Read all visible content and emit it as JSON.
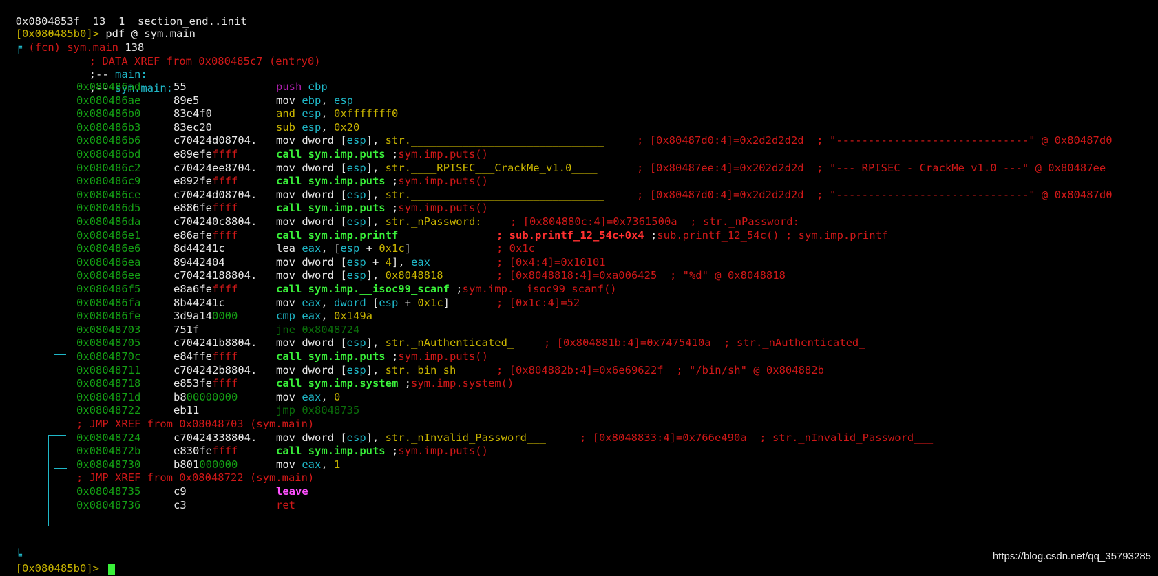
{
  "header": {
    "line1": "0x0804853f  13  1  section_end..init",
    "prompt_addr": "[0x080485b0]>",
    "command": " pdf @ sym.main"
  },
  "func": {
    "marker": "╒",
    "label": " (fcn) sym.main",
    "size": " 138"
  },
  "xref1": "; DATA XREF from 0x080485c7 (entry0)",
  "labels": [
    {
      "prefix": ";-- ",
      "name": "main:"
    },
    {
      "prefix": ";-- ",
      "name": "sym.main:"
    }
  ],
  "rows": [
    {
      "addr": "0x080486ad",
      "bytes": "55",
      "bytes_tail": "",
      "ins": [
        {
          "t": "push",
          "c": "m"
        },
        {
          "t": " ebp",
          "c": "cy"
        }
      ],
      "comment": []
    },
    {
      "addr": "0x080486ae",
      "bytes": "89e5",
      "bytes_tail": "",
      "ins": [
        {
          "t": "mov ",
          "c": "w"
        },
        {
          "t": "ebp",
          "c": "cy"
        },
        {
          "t": ", ",
          "c": "w"
        },
        {
          "t": "esp",
          "c": "cy"
        }
      ],
      "comment": []
    },
    {
      "addr": "0x080486b0",
      "bytes": "83e4f0",
      "bytes_tail": "",
      "ins": [
        {
          "t": "and ",
          "c": "y"
        },
        {
          "t": "esp",
          "c": "cy"
        },
        {
          "t": ", ",
          "c": "w"
        },
        {
          "t": "0xfffffff0",
          "c": "y"
        }
      ],
      "comment": []
    },
    {
      "addr": "0x080486b3",
      "bytes": "83ec20",
      "bytes_tail": "",
      "ins": [
        {
          "t": "sub ",
          "c": "y"
        },
        {
          "t": "esp",
          "c": "cy"
        },
        {
          "t": ", ",
          "c": "w"
        },
        {
          "t": "0x20",
          "c": "y"
        }
      ],
      "comment": []
    },
    {
      "addr": "0x080486b6",
      "bytes": "c70424d08704.",
      "bytes_tail": "",
      "ins": [
        {
          "t": "mov dword [",
          "c": "w"
        },
        {
          "t": "esp",
          "c": "cy"
        },
        {
          "t": "], ",
          "c": "w"
        },
        {
          "t": "str.",
          "c": "y"
        },
        {
          "t": "______________________________",
          "c": "y"
        }
      ],
      "comment": [
        {
          "t": "; [0x80487d0:4]=0x2d2d2d2d  ; \"------------------------------\" @ 0x80487d0",
          "c": "r"
        }
      ]
    },
    {
      "addr": "0x080486bd",
      "bytes": "e89efe",
      "bytes_tail": "ffff",
      "ins": [
        {
          "t": "call sym.imp.puts",
          "c": "gb"
        },
        {
          "t": " ;",
          "c": "w"
        },
        {
          "t": "sym.imp.puts()",
          "c": "r"
        }
      ],
      "comment": []
    },
    {
      "addr": "0x080486c2",
      "bytes": "c70424ee8704.",
      "bytes_tail": "",
      "ins": [
        {
          "t": "mov dword [",
          "c": "w"
        },
        {
          "t": "esp",
          "c": "cy"
        },
        {
          "t": "], ",
          "c": "w"
        },
        {
          "t": "str.____RPISEC___CrackMe_v1.0____",
          "c": "y"
        }
      ],
      "comment": [
        {
          "t": "; [0x80487ee:4]=0x202d2d2d  ; \"--- RPISEC - CrackMe v1.0 ---\" @ 0x80487ee",
          "c": "r"
        }
      ]
    },
    {
      "addr": "0x080486c9",
      "bytes": "e892fe",
      "bytes_tail": "ffff",
      "ins": [
        {
          "t": "call sym.imp.puts",
          "c": "gb"
        },
        {
          "t": " ;",
          "c": "w"
        },
        {
          "t": "sym.imp.puts()",
          "c": "r"
        }
      ],
      "comment": []
    },
    {
      "addr": "0x080486ce",
      "bytes": "c70424d08704.",
      "bytes_tail": "",
      "ins": [
        {
          "t": "mov dword [",
          "c": "w"
        },
        {
          "t": "esp",
          "c": "cy"
        },
        {
          "t": "], ",
          "c": "w"
        },
        {
          "t": "str.",
          "c": "y"
        },
        {
          "t": "______________________________",
          "c": "y"
        }
      ],
      "comment": [
        {
          "t": "; [0x80487d0:4]=0x2d2d2d2d  ; \"------------------------------\" @ 0x80487d0",
          "c": "r"
        }
      ]
    },
    {
      "addr": "0x080486d5",
      "bytes": "e886fe",
      "bytes_tail": "ffff",
      "ins": [
        {
          "t": "call sym.imp.puts",
          "c": "gb"
        },
        {
          "t": " ;",
          "c": "w"
        },
        {
          "t": "sym.imp.puts()",
          "c": "r"
        }
      ],
      "comment": []
    },
    {
      "addr": "0x080486da",
      "bytes": "c704240c8804.",
      "bytes_tail": "",
      "ins": [
        {
          "t": "mov dword [",
          "c": "w"
        },
        {
          "t": "esp",
          "c": "cy"
        },
        {
          "t": "], ",
          "c": "w"
        },
        {
          "t": "str._nPassword:",
          "c": "y"
        }
      ],
      "comment": [
        {
          "t": "; [0x804880c:4]=0x7361500a  ; str._nPassword:",
          "c": "r"
        }
      ]
    },
    {
      "addr": "0x080486e1",
      "bytes": "e86afe",
      "bytes_tail": "ffff",
      "ins": [
        {
          "t": "call sym.imp.printf",
          "c": "gb"
        }
      ],
      "comment": [
        {
          "t": "; sub.printf_12_54c+0x4",
          "c": "rb"
        },
        {
          "t": " ;",
          "c": "w"
        },
        {
          "t": "sub.printf_12_54c() ; sym.imp.printf",
          "c": "r"
        }
      ]
    },
    {
      "addr": "0x080486e6",
      "bytes": "8d44241c",
      "bytes_tail": "",
      "ins": [
        {
          "t": "lea ",
          "c": "w"
        },
        {
          "t": "eax",
          "c": "cy"
        },
        {
          "t": ", [",
          "c": "w"
        },
        {
          "t": "esp",
          "c": "cy"
        },
        {
          "t": " + ",
          "c": "w"
        },
        {
          "t": "0x1c",
          "c": "y"
        },
        {
          "t": "]",
          "c": "w"
        }
      ],
      "comment": [
        {
          "t": "; 0x1c",
          "c": "r"
        }
      ]
    },
    {
      "addr": "0x080486ea",
      "bytes": "89442404",
      "bytes_tail": "",
      "ins": [
        {
          "t": "mov dword [",
          "c": "w"
        },
        {
          "t": "esp",
          "c": "cy"
        },
        {
          "t": " + ",
          "c": "w"
        },
        {
          "t": "4",
          "c": "y"
        },
        {
          "t": "], ",
          "c": "w"
        },
        {
          "t": "eax",
          "c": "cy"
        }
      ],
      "comment": [
        {
          "t": "; [0x4:4]=0x10101",
          "c": "r"
        }
      ]
    },
    {
      "addr": "0x080486ee",
      "bytes": "c70424188804.",
      "bytes_tail": "",
      "ins": [
        {
          "t": "mov dword [",
          "c": "w"
        },
        {
          "t": "esp",
          "c": "cy"
        },
        {
          "t": "], ",
          "c": "w"
        },
        {
          "t": "0x8048818",
          "c": "y"
        }
      ],
      "comment": [
        {
          "t": "; [0x8048818:4]=0xa006425  ; \"%d\" @ 0x8048818",
          "c": "r"
        }
      ]
    },
    {
      "addr": "0x080486f5",
      "bytes": "e8a6fe",
      "bytes_tail": "ffff",
      "ins": [
        {
          "t": "call sym.imp.__isoc99_scanf",
          "c": "gb"
        },
        {
          "t": " ;",
          "c": "w"
        },
        {
          "t": "sym.imp.__isoc99_scanf()",
          "c": "r"
        }
      ],
      "comment": []
    },
    {
      "addr": "0x080486fa",
      "bytes": "8b44241c",
      "bytes_tail": "",
      "ins": [
        {
          "t": "mov ",
          "c": "w"
        },
        {
          "t": "eax",
          "c": "cy"
        },
        {
          "t": ", ",
          "c": "w"
        },
        {
          "t": "dword",
          "c": "cy"
        },
        {
          "t": " [",
          "c": "w"
        },
        {
          "t": "esp",
          "c": "cy"
        },
        {
          "t": " + ",
          "c": "w"
        },
        {
          "t": "0x1c",
          "c": "y"
        },
        {
          "t": "]",
          "c": "w"
        }
      ],
      "comment": [
        {
          "t": "; [0x1c:4]=52",
          "c": "r"
        }
      ]
    },
    {
      "addr": "0x080486fe",
      "bytes": "3d9a14",
      "bytes_tail": "0000",
      "ins": [
        {
          "t": "cmp ",
          "c": "cy"
        },
        {
          "t": "eax",
          "c": "cy"
        },
        {
          "t": ", ",
          "c": "w"
        },
        {
          "t": "0x149a",
          "c": "y"
        }
      ],
      "comment": []
    },
    {
      "addr": "0x08048703",
      "bytes": "751f",
      "bytes_tail": "",
      "ins": [
        {
          "t": "jne 0x8048724",
          "c": "dg"
        }
      ],
      "comment": []
    },
    {
      "addr": "0x08048705",
      "bytes": "c704241b8804.",
      "bytes_tail": "",
      "ins": [
        {
          "t": "mov dword [",
          "c": "w"
        },
        {
          "t": "esp",
          "c": "cy"
        },
        {
          "t": "], ",
          "c": "w"
        },
        {
          "t": "str._nAuthenticated_",
          "c": "y"
        }
      ],
      "comment": [
        {
          "t": "; [0x804881b:4]=0x7475410a  ; str._nAuthenticated_",
          "c": "r"
        }
      ]
    },
    {
      "addr": "0x0804870c",
      "bytes": "e84ffe",
      "bytes_tail": "ffff",
      "ins": [
        {
          "t": "call sym.imp.puts",
          "c": "gb"
        },
        {
          "t": " ;",
          "c": "w"
        },
        {
          "t": "sym.imp.puts()",
          "c": "r"
        }
      ],
      "comment": []
    },
    {
      "addr": "0x08048711",
      "bytes": "c704242b8804.",
      "bytes_tail": "",
      "ins": [
        {
          "t": "mov dword [",
          "c": "w"
        },
        {
          "t": "esp",
          "c": "cy"
        },
        {
          "t": "], ",
          "c": "w"
        },
        {
          "t": "str._bin_sh",
          "c": "y"
        }
      ],
      "comment": [
        {
          "t": "; [0x804882b:4]=0x6e69622f  ; \"/bin/sh\" @ 0x804882b",
          "c": "r"
        }
      ]
    },
    {
      "addr": "0x08048718",
      "bytes": "e853fe",
      "bytes_tail": "ffff",
      "ins": [
        {
          "t": "call sym.imp.system",
          "c": "gb"
        },
        {
          "t": " ;",
          "c": "w"
        },
        {
          "t": "sym.imp.system()",
          "c": "r"
        }
      ],
      "comment": []
    },
    {
      "addr": "0x0804871d",
      "bytes": "b8",
      "bytes_tail": "00000000",
      "ins": [
        {
          "t": "mov ",
          "c": "w"
        },
        {
          "t": "eax",
          "c": "cy"
        },
        {
          "t": ", ",
          "c": "w"
        },
        {
          "t": "0",
          "c": "y"
        }
      ],
      "comment": []
    },
    {
      "addr": "0x08048722",
      "bytes": "eb11",
      "bytes_tail": "",
      "ins": [
        {
          "t": "jmp 0x8048735",
          "c": "dg"
        }
      ],
      "comment": []
    },
    {
      "addr": "",
      "bytes": "",
      "bytes_tail": "",
      "xref": "; JMP XREF from 0x08048703 (sym.main)",
      "ins": [],
      "comment": []
    },
    {
      "addr": "0x08048724",
      "bytes": "c70424338804.",
      "bytes_tail": "",
      "ins": [
        {
          "t": "mov dword [",
          "c": "w"
        },
        {
          "t": "esp",
          "c": "cy"
        },
        {
          "t": "], ",
          "c": "w"
        },
        {
          "t": "str._nInvalid_Password___",
          "c": "y"
        }
      ],
      "comment": [
        {
          "t": "; [0x8048833:4]=0x766e490a  ; str._nInvalid_Password___",
          "c": "r"
        }
      ]
    },
    {
      "addr": "0x0804872b",
      "bytes": "e830fe",
      "bytes_tail": "ffff",
      "ins": [
        {
          "t": "call sym.imp.puts",
          "c": "gb"
        },
        {
          "t": " ;",
          "c": "w"
        },
        {
          "t": "sym.imp.puts()",
          "c": "r"
        }
      ],
      "comment": []
    },
    {
      "addr": "0x08048730",
      "bytes": "b801",
      "bytes_tail": "000000",
      "ins": [
        {
          "t": "mov ",
          "c": "w"
        },
        {
          "t": "eax",
          "c": "cy"
        },
        {
          "t": ", ",
          "c": "w"
        },
        {
          "t": "1",
          "c": "y"
        }
      ],
      "comment": []
    },
    {
      "addr": "",
      "bytes": "",
      "bytes_tail": "",
      "xref": "; JMP XREF from 0x08048722 (sym.main)",
      "ins": [],
      "comment": []
    },
    {
      "addr": "0x08048735",
      "bytes": "c9",
      "bytes_tail": "",
      "ins": [
        {
          "t": "leave",
          "c": "mb"
        }
      ],
      "comment": []
    },
    {
      "addr": "0x08048736",
      "bytes": "c3",
      "bytes_tail": "",
      "ins": [
        {
          "t": "ret",
          "c": "r"
        }
      ],
      "comment": []
    }
  ],
  "footer": {
    "func_end": "╘",
    "prompt_addr": "[0x080485b0]>",
    "command": " "
  },
  "watermark": "https://blog.csdn.net/qq_35793285",
  "colors": {
    "background": "#000000",
    "address": "#14a014",
    "prompt": "#c8b400",
    "comment": "#d01818",
    "call": "#3af03a",
    "register": "#1fb8c8",
    "push": "#b020b0"
  }
}
